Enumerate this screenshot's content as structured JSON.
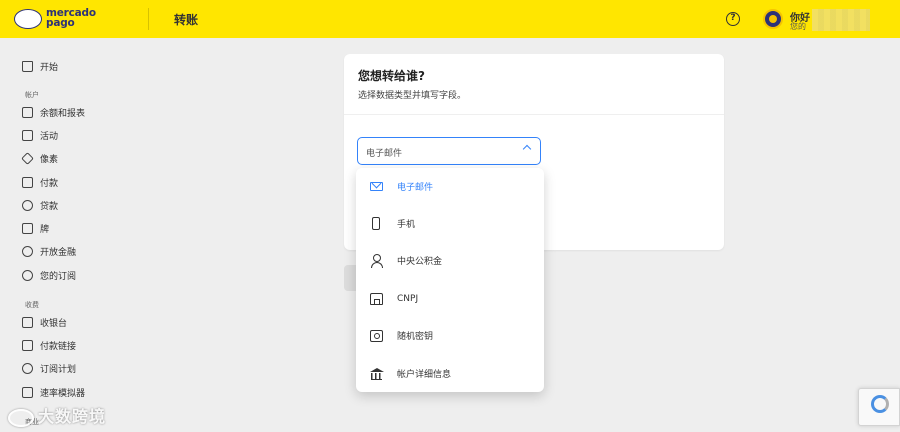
{
  "brand": {
    "logo_line1": "mercado",
    "logo_line2": "pago"
  },
  "header": {
    "title": "转账",
    "help": "?",
    "user_name": "你好",
    "user_sub": "您的"
  },
  "sidebar": {
    "items": [
      {
        "label": "开始",
        "icon": "home-icon"
      },
      {
        "label": "余额和报表",
        "icon": "wallet-icon"
      },
      {
        "label": "活动",
        "icon": "activity-icon"
      },
      {
        "label": "像素",
        "icon": "pix-icon"
      },
      {
        "label": "付款",
        "icon": "payment-icon"
      },
      {
        "label": "贷款",
        "icon": "loan-icon"
      },
      {
        "label": "牌",
        "icon": "card-icon"
      },
      {
        "label": "开放金融",
        "icon": "open-finance-icon"
      },
      {
        "label": "您的订阅",
        "icon": "subscription-icon"
      },
      {
        "label": "收银台",
        "icon": "cashier-icon"
      },
      {
        "label": "付款链接",
        "icon": "link-icon"
      },
      {
        "label": "订阅计划",
        "icon": "plan-icon"
      },
      {
        "label": "速率模拟器",
        "icon": "simulator-icon"
      }
    ],
    "sections": {
      "account": "帐户",
      "collect": "收费",
      "business": "商业"
    }
  },
  "card": {
    "title": "您想转给谁?",
    "subtitle": "选择数据类型并填写字段。",
    "select_value": "电子邮件"
  },
  "dropdown": {
    "options": [
      {
        "label": "电子邮件",
        "icon": "email-icon",
        "selected": true
      },
      {
        "label": "手机",
        "icon": "phone-icon",
        "selected": false
      },
      {
        "label": "中央公积金",
        "icon": "person-icon",
        "selected": false
      },
      {
        "label": "CNPJ",
        "icon": "store-icon",
        "selected": false
      },
      {
        "label": "随机密钥",
        "icon": "key-icon",
        "selected": false
      },
      {
        "label": "帐户详细信息",
        "icon": "bank-icon",
        "selected": false
      }
    ]
  },
  "watermark": "大数跨境",
  "colors": {
    "header_bg": "#ffe600",
    "accent": "#3483fa",
    "brand_navy": "#2d3277"
  }
}
